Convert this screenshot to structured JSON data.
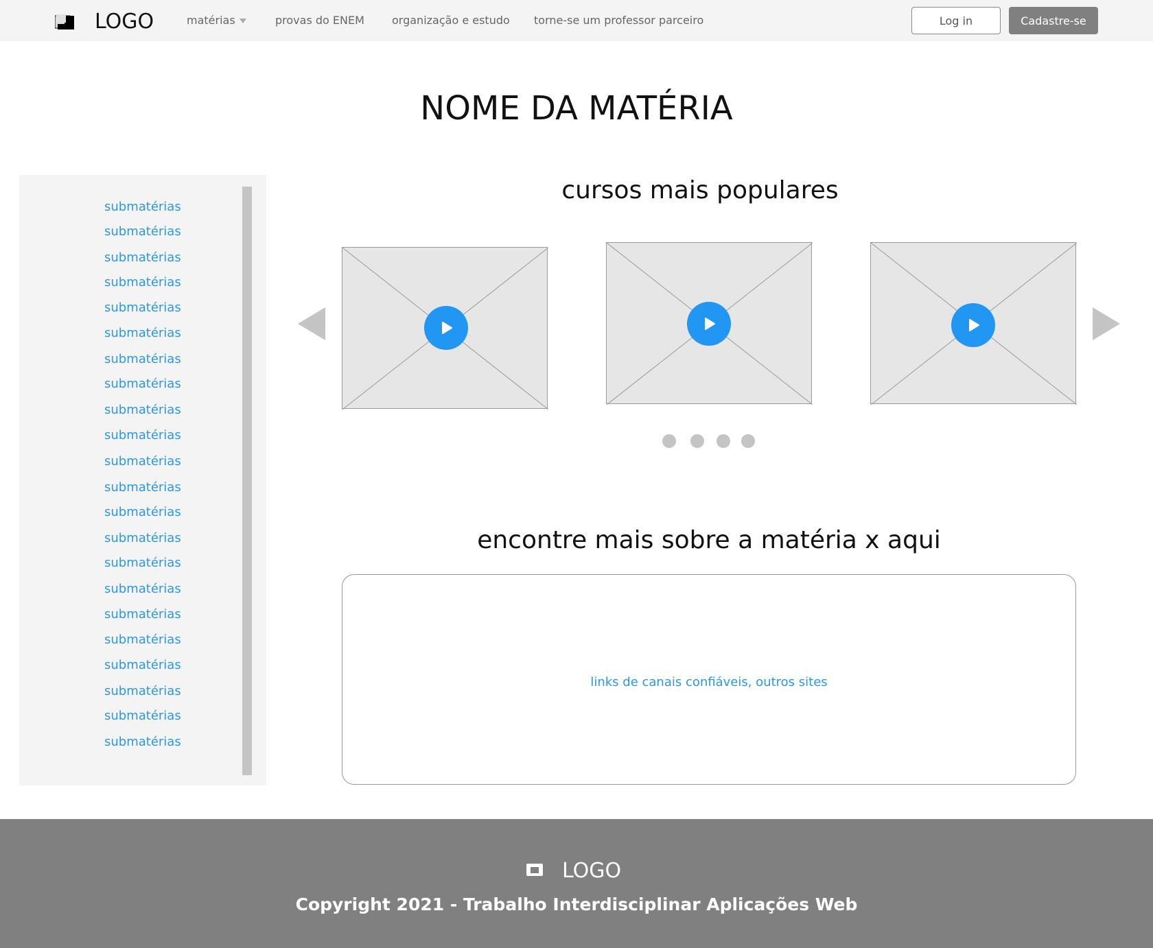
{
  "header": {
    "logo_text": "LOGO",
    "nav": {
      "materias": "matérias",
      "provas": "provas do ENEM",
      "organizacao": "organização e estudo",
      "professor": "torne-se um professor parceiro"
    },
    "login_label": "Log in",
    "signup_label": "Cadastre-se"
  },
  "page_title": "NOME DA MATÉRIA",
  "sidebar": {
    "items": [
      "submatérias",
      "submatérias",
      "submatérias",
      "submatérias",
      "submatérias",
      "submatérias",
      "submatérias",
      "submatérias",
      "submatérias",
      "submatérias",
      "submatérias",
      "submatérias",
      "submatérias",
      "submatérias",
      "submatérias",
      "submatérias",
      "submatérias",
      "submatérias",
      "submatérias",
      "submatérias",
      "submatérias",
      "submatérias"
    ]
  },
  "popular": {
    "title": "cursos mais populares",
    "video_count": 3,
    "dot_count": 4
  },
  "more": {
    "title": "encontre mais sobre a matéria x aqui",
    "links_text": "links de canais confiáveis, outros sites"
  },
  "footer": {
    "logo_text": "LOGO",
    "copyright": "Copyright 2021 - Trabalho Interdisciplinar Aplicações Web"
  },
  "colors": {
    "link_blue": "#2a97ea",
    "play_blue": "#2196f3",
    "header_bg": "#f4f4f4",
    "footer_bg": "#808080"
  }
}
